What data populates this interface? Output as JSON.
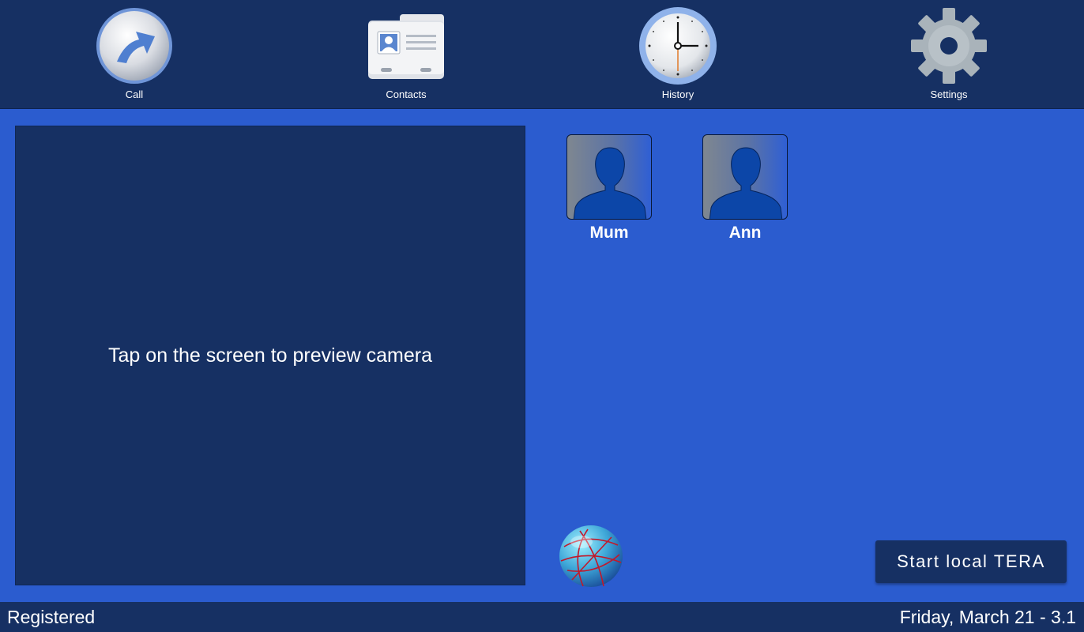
{
  "toolbar": {
    "items": [
      {
        "label": "Call",
        "icon": "call-arrow-icon"
      },
      {
        "label": "Contacts",
        "icon": "contacts-card-icon"
      },
      {
        "label": "History",
        "icon": "clock-icon"
      },
      {
        "label": "Settings",
        "icon": "gear-icon"
      }
    ]
  },
  "preview": {
    "text": "Tap on the screen to preview camera"
  },
  "contacts": [
    {
      "name": "Mum",
      "icon": "person-silhouette-icon"
    },
    {
      "name": "Ann",
      "icon": "person-silhouette-icon"
    }
  ],
  "globe": {
    "icon": "network-globe-icon"
  },
  "start_button": {
    "label": "Start local TERA"
  },
  "status": {
    "left": "Registered",
    "right": "Friday, March 21 - 3.1"
  },
  "colors": {
    "background": "#2b5ccf",
    "panel": "#163063",
    "text": "#ffffff",
    "avatar_silhouette": "#0c46a8"
  }
}
